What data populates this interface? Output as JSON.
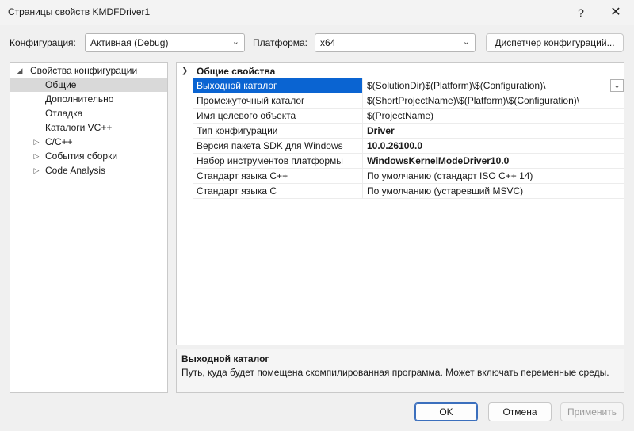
{
  "window": {
    "title": "Страницы свойств KMDFDriver1",
    "help_glyph": "?",
    "close_glyph": "✕"
  },
  "toolbar": {
    "config_label": "Конфигурация:",
    "config_value": "Активная (Debug)",
    "platform_label": "Платформа:",
    "platform_value": "x64",
    "config_manager_label": "Диспетчер конфигураций..."
  },
  "tree": {
    "root": {
      "label": "Свойства конфигурации",
      "expander": "◢"
    },
    "items": [
      {
        "label": "Общие",
        "expander": ""
      },
      {
        "label": "Дополнительно",
        "expander": ""
      },
      {
        "label": "Отладка",
        "expander": ""
      },
      {
        "label": "Каталоги VC++",
        "expander": ""
      },
      {
        "label": "C/C++",
        "expander": "▷"
      },
      {
        "label": "События сборки",
        "expander": "▷"
      },
      {
        "label": "Code Analysis",
        "expander": "▷"
      }
    ],
    "selected": "Общие"
  },
  "grid": {
    "category_label": "Общие свойства",
    "rows": [
      {
        "name": "Выходной каталог",
        "value": "$(SolutionDir)$(Platform)\\$(Configuration)\\",
        "bold": false
      },
      {
        "name": "Промежуточный каталог",
        "value": "$(ShortProjectName)\\$(Platform)\\$(Configuration)\\",
        "bold": false
      },
      {
        "name": "Имя целевого объекта",
        "value": "$(ProjectName)",
        "bold": false
      },
      {
        "name": "Тип конфигурации",
        "value": "Driver",
        "bold": true
      },
      {
        "name": "Версия пакета SDK для Windows",
        "value": "10.0.26100.0",
        "bold": true
      },
      {
        "name": "Набор инструментов платформы",
        "value": "WindowsKernelModeDriver10.0",
        "bold": true
      },
      {
        "name": "Стандарт языка C++",
        "value": "По умолчанию (стандарт ISO C++ 14)",
        "bold": false
      },
      {
        "name": "Стандарт языка C",
        "value": "По умолчанию (устаревший MSVC)",
        "bold": false
      }
    ],
    "selected_row": "Выходной каталог"
  },
  "description": {
    "title": "Выходной каталог",
    "text": "Путь, куда будет помещена скомпилированная программа. Может включать переменные среды."
  },
  "buttons": {
    "ok": "OK",
    "cancel": "Отмена",
    "apply": "Применить"
  },
  "colors": {
    "selection": "#0a64d2",
    "tree_selection": "#d9d9d9",
    "background": "#f0f0f0"
  }
}
